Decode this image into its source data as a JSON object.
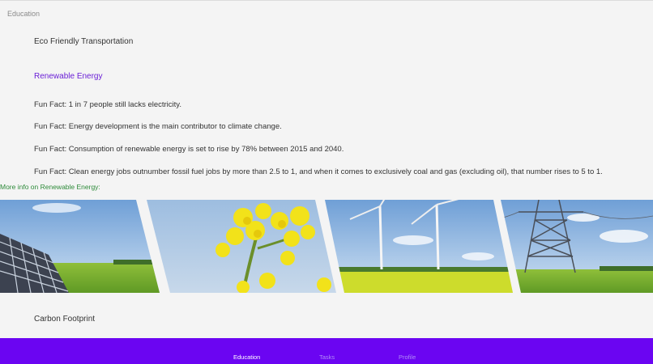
{
  "header": {
    "title": "Education"
  },
  "categories": {
    "transportation": "Eco Friendly Transportation",
    "renewable": "Renewable Energy",
    "carbon": "Carbon Footprint"
  },
  "facts": [
    "Fun Fact: 1 in 7 people still lacks electricity.",
    "Fun Fact: Energy development is the main contributor to climate change.",
    "Fun Fact: Consumption of renewable energy is set to rise by 78% between 2015 and 2040.",
    "Fun Fact: Clean energy jobs outnumber fossil fuel jobs by more than 2.5 to 1, and when it comes to exclusively coal and gas (excluding oil), that number rises to 5 to 1."
  ],
  "more_info": "More info on Renewable Energy:",
  "banner": {
    "panels": [
      "solar-panel",
      "rapeseed-flower",
      "wind-turbines",
      "power-pylon"
    ]
  },
  "nav": {
    "items": [
      {
        "label": "Education",
        "active": true
      },
      {
        "label": "Tasks",
        "active": false
      },
      {
        "label": "Profile",
        "active": false
      }
    ]
  },
  "colors": {
    "accent": "#6a1fd6",
    "nav_bar": "#6b05f2",
    "link_green": "#2e8b3a"
  }
}
